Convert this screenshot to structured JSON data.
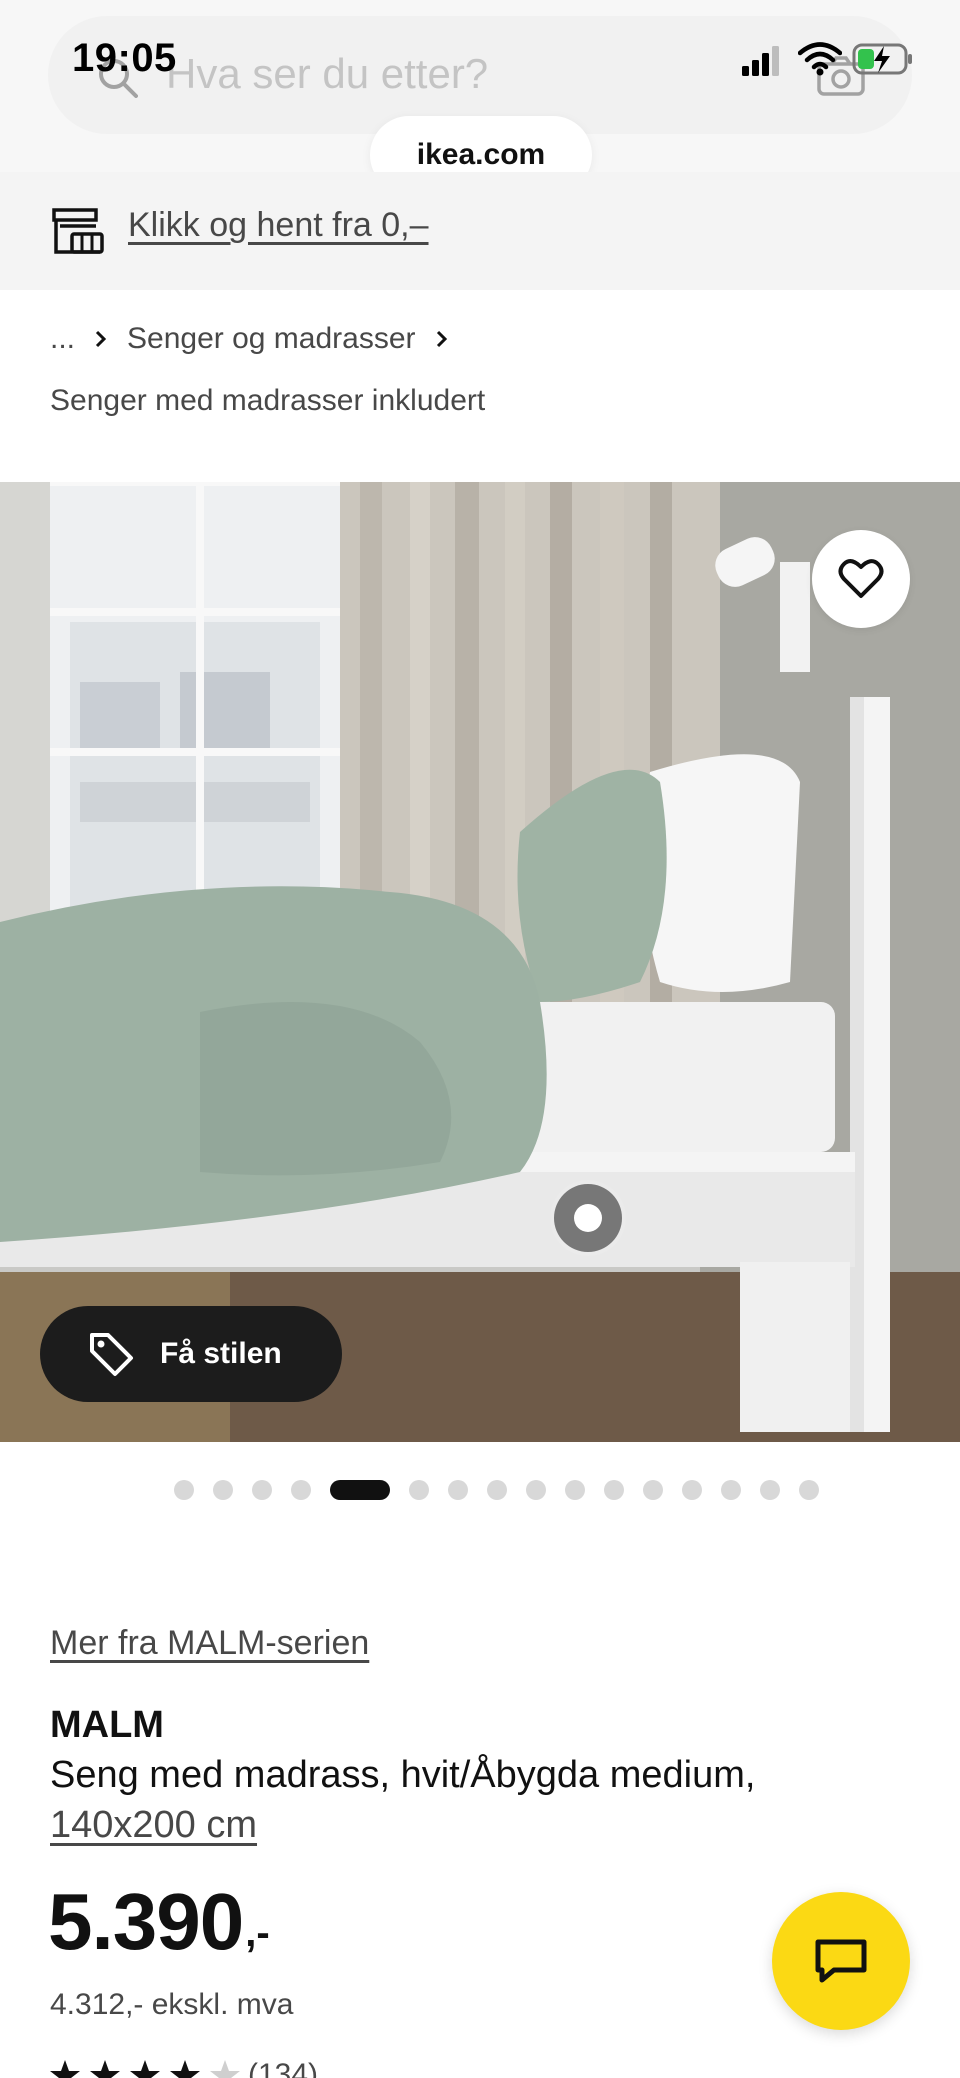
{
  "status_bar": {
    "time": "19:05",
    "icons": [
      "signal-icon",
      "wifi-icon",
      "battery-charging-icon"
    ]
  },
  "search": {
    "placeholder": "Hva ser du etter?",
    "icons": [
      "search-icon",
      "camera-icon"
    ]
  },
  "browser": {
    "url": "ikea.com"
  },
  "store_banner": {
    "link_text": "Klikk og hent fra 0,–",
    "icon": "store-icon"
  },
  "breadcrumb": {
    "ellipsis": "...",
    "category": "Senger og madrasser",
    "current": "Senger med madrasser inkludert"
  },
  "hero": {
    "favourite_icon": "heart-icon",
    "style_button_label": "Få stilen",
    "style_button_icon": "tag-icon",
    "carousel": {
      "total": 16,
      "active_index": 4
    }
  },
  "product": {
    "series_link": "Mer fra MALM-serien",
    "name": "MALM",
    "description": "Seng med madrass, hvit/Åbygda medium,",
    "size": "140x200 cm",
    "price": "5.390",
    "price_suffix": ",-",
    "price_excl_vat": "4.312,- ekskl. mva",
    "rating_count": "(134)"
  },
  "chat": {
    "icon": "chat-icon",
    "color": "#fbd914"
  },
  "colors": {
    "accent_yellow": "#fbd914",
    "text_primary": "#111111",
    "text_secondary": "#484848"
  }
}
